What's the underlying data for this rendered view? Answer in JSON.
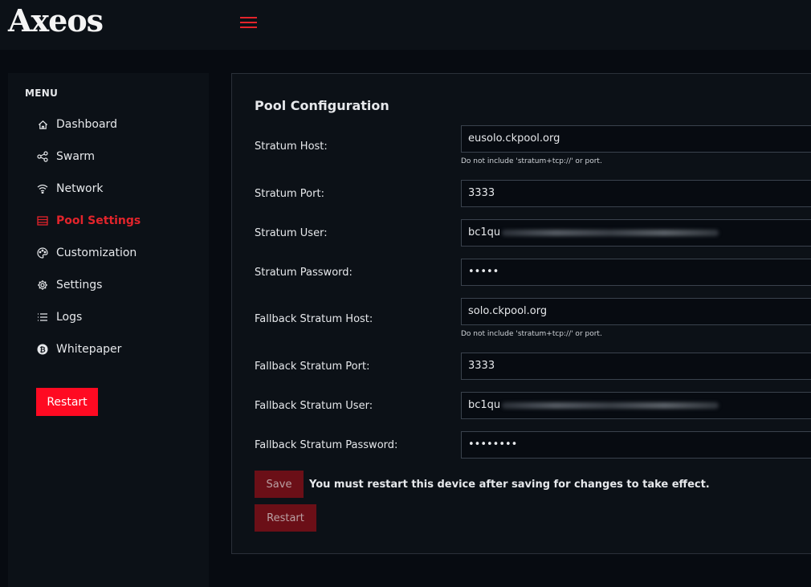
{
  "app": {
    "logo_text": "Axeos"
  },
  "sidebar": {
    "menu_title": "MENU",
    "items": [
      {
        "label": "Dashboard",
        "icon": "home-icon"
      },
      {
        "label": "Swarm",
        "icon": "share-icon"
      },
      {
        "label": "Network",
        "icon": "wifi-icon"
      },
      {
        "label": "Pool Settings",
        "icon": "server-icon",
        "active": true
      },
      {
        "label": "Customization",
        "icon": "palette-icon"
      },
      {
        "label": "Settings",
        "icon": "gear-icon"
      },
      {
        "label": "Logs",
        "icon": "list-icon"
      },
      {
        "label": "Whitepaper",
        "icon": "bitcoin-icon"
      }
    ],
    "restart_label": "Restart"
  },
  "pool": {
    "title": "Pool Configuration",
    "fields": [
      {
        "label": "Stratum Host:",
        "value": "eusolo.ckpool.org",
        "hint": "Do not include 'stratum+tcp://' or port."
      },
      {
        "label": "Stratum Port:",
        "value": "3333"
      },
      {
        "label": "Stratum User:",
        "value": "bc1qu"
      },
      {
        "label": "Stratum Password:",
        "value": "•••••"
      },
      {
        "label": "Fallback Stratum Host:",
        "value": "solo.ckpool.org",
        "hint": "Do not include 'stratum+tcp://' or port."
      },
      {
        "label": "Fallback Stratum Port:",
        "value": "3333"
      },
      {
        "label": "Fallback Stratum User:",
        "value": "bc1qu"
      },
      {
        "label": "Fallback Stratum Password:",
        "value": "••••••••"
      }
    ],
    "save_label": "Save",
    "restart_note": "You must restart this device after saving for changes to take effect.",
    "restart_label": "Restart"
  },
  "colors": {
    "accent": "#e3242b",
    "background": "#070b11",
    "panel": "#0c1117"
  }
}
